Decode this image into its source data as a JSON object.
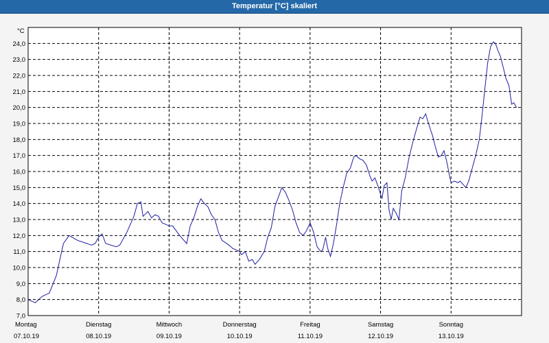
{
  "window": {
    "title": "Temperatur [°C] skaliert"
  },
  "colors": {
    "titlebar": "#2468a8",
    "line": "#1c1ca0",
    "grid": "#000000",
    "background": "#ffffff"
  },
  "chart_data": {
    "type": "line",
    "title": "Temperatur [°C] skaliert",
    "ylabel": "°C",
    "xlabel": "",
    "ylim": [
      7.0,
      25.0
    ],
    "yticks": [
      "7,0",
      "8,0",
      "9,0",
      "10,0",
      "11,0",
      "12,0",
      "13,0",
      "14,0",
      "15,0",
      "16,0",
      "17,0",
      "18,0",
      "19,0",
      "20,0",
      "21,0",
      "22,0",
      "23,0",
      "24,0"
    ],
    "x_categories": [
      {
        "day": "Montag",
        "date": "07.10.19"
      },
      {
        "day": "Dienstag",
        "date": "08.10.19"
      },
      {
        "day": "Mittwoch",
        "date": "09.10.19"
      },
      {
        "day": "Donnerstag",
        "date": "10.10.19"
      },
      {
        "day": "Freitag",
        "date": "11.10.19"
      },
      {
        "day": "Samstag",
        "date": "12.10.19"
      },
      {
        "day": "Sonntag",
        "date": "13.10.19"
      }
    ],
    "grid": true,
    "series": [
      {
        "x_unit": "days since 07.10.19 00:00",
        "points": [
          [
            0.0,
            8.0
          ],
          [
            0.1,
            7.8
          ],
          [
            0.2,
            8.2
          ],
          [
            0.3,
            8.4
          ],
          [
            0.4,
            9.5
          ],
          [
            0.5,
            11.5
          ],
          [
            0.58,
            12.0
          ],
          [
            0.7,
            11.7
          ],
          [
            0.9,
            11.4
          ],
          [
            0.95,
            11.5
          ],
          [
            1.0,
            11.9
          ],
          [
            1.05,
            12.1
          ],
          [
            1.1,
            11.5
          ],
          [
            1.25,
            11.3
          ],
          [
            1.3,
            11.4
          ],
          [
            1.4,
            12.2
          ],
          [
            1.5,
            13.2
          ],
          [
            1.55,
            14.0
          ],
          [
            1.6,
            14.1
          ],
          [
            1.63,
            13.2
          ],
          [
            1.7,
            13.5
          ],
          [
            1.75,
            13.1
          ],
          [
            1.8,
            13.3
          ],
          [
            1.85,
            13.2
          ],
          [
            1.9,
            12.8
          ],
          [
            2.0,
            12.6
          ],
          [
            2.05,
            12.6
          ],
          [
            2.1,
            12.3
          ],
          [
            2.15,
            12.0
          ],
          [
            2.25,
            11.5
          ],
          [
            2.3,
            12.6
          ],
          [
            2.35,
            13.1
          ],
          [
            2.4,
            13.8
          ],
          [
            2.45,
            14.3
          ],
          [
            2.5,
            14.0
          ],
          [
            2.55,
            13.8
          ],
          [
            2.6,
            13.3
          ],
          [
            2.65,
            13.0
          ],
          [
            2.7,
            12.2
          ],
          [
            2.75,
            11.7
          ],
          [
            2.85,
            11.4
          ],
          [
            2.9,
            11.2
          ],
          [
            3.0,
            11.0
          ],
          [
            3.03,
            10.8
          ],
          [
            3.08,
            11.0
          ],
          [
            3.13,
            10.4
          ],
          [
            3.18,
            10.5
          ],
          [
            3.22,
            10.2
          ],
          [
            3.28,
            10.5
          ],
          [
            3.35,
            11.0
          ],
          [
            3.4,
            11.9
          ],
          [
            3.45,
            12.5
          ],
          [
            3.5,
            13.8
          ],
          [
            3.55,
            14.4
          ],
          [
            3.6,
            15.0
          ],
          [
            3.65,
            14.7
          ],
          [
            3.7,
            14.2
          ],
          [
            3.75,
            13.6
          ],
          [
            3.8,
            12.8
          ],
          [
            3.85,
            12.2
          ],
          [
            3.9,
            12.0
          ],
          [
            3.95,
            12.3
          ],
          [
            4.0,
            12.8
          ],
          [
            4.05,
            12.2
          ],
          [
            4.1,
            11.3
          ],
          [
            4.15,
            11.0
          ],
          [
            4.18,
            11.1
          ],
          [
            4.22,
            11.9
          ],
          [
            4.25,
            11.2
          ],
          [
            4.29,
            10.7
          ],
          [
            4.33,
            11.5
          ],
          [
            4.38,
            12.8
          ],
          [
            4.42,
            14.0
          ],
          [
            4.47,
            15.0
          ],
          [
            4.52,
            15.9
          ],
          [
            4.57,
            16.2
          ],
          [
            4.62,
            16.9
          ],
          [
            4.65,
            17.0
          ],
          [
            4.7,
            16.8
          ],
          [
            4.75,
            16.7
          ],
          [
            4.8,
            16.4
          ],
          [
            4.85,
            15.7
          ],
          [
            4.88,
            15.4
          ],
          [
            4.92,
            15.6
          ],
          [
            4.97,
            15.0
          ],
          [
            5.02,
            14.3
          ],
          [
            5.05,
            15.1
          ],
          [
            5.09,
            15.3
          ],
          [
            5.12,
            13.6
          ],
          [
            5.15,
            13.0
          ],
          [
            5.18,
            13.7
          ],
          [
            5.22,
            13.4
          ],
          [
            5.26,
            13.0
          ],
          [
            5.3,
            14.8
          ],
          [
            5.35,
            15.6
          ],
          [
            5.4,
            16.8
          ],
          [
            5.45,
            17.7
          ],
          [
            5.5,
            18.5
          ],
          [
            5.56,
            19.4
          ],
          [
            5.6,
            19.3
          ],
          [
            5.64,
            19.6
          ],
          [
            5.68,
            19.0
          ],
          [
            5.74,
            18.2
          ],
          [
            5.78,
            17.5
          ],
          [
            5.82,
            16.9
          ],
          [
            5.86,
            17.0
          ],
          [
            5.9,
            17.3
          ],
          [
            5.94,
            16.6
          ],
          [
            5.98,
            15.7
          ],
          [
            6.0,
            15.3
          ],
          [
            6.05,
            15.4
          ],
          [
            6.1,
            15.3
          ],
          [
            6.13,
            15.4
          ],
          [
            6.17,
            15.2
          ],
          [
            6.21,
            15.0
          ],
          [
            6.25,
            15.4
          ],
          [
            6.3,
            16.2
          ],
          [
            6.35,
            17.0
          ],
          [
            6.4,
            18.0
          ],
          [
            6.44,
            19.5
          ],
          [
            6.48,
            21.2
          ],
          [
            6.52,
            22.8
          ],
          [
            6.56,
            23.8
          ],
          [
            6.6,
            24.1
          ],
          [
            6.63,
            24.0
          ],
          [
            6.67,
            23.5
          ],
          [
            6.7,
            23.2
          ],
          [
            6.74,
            22.5
          ],
          [
            6.78,
            21.8
          ],
          [
            6.82,
            21.4
          ],
          [
            6.86,
            20.2
          ],
          [
            6.89,
            20.3
          ],
          [
            6.93,
            20.0
          ]
        ]
      }
    ]
  }
}
